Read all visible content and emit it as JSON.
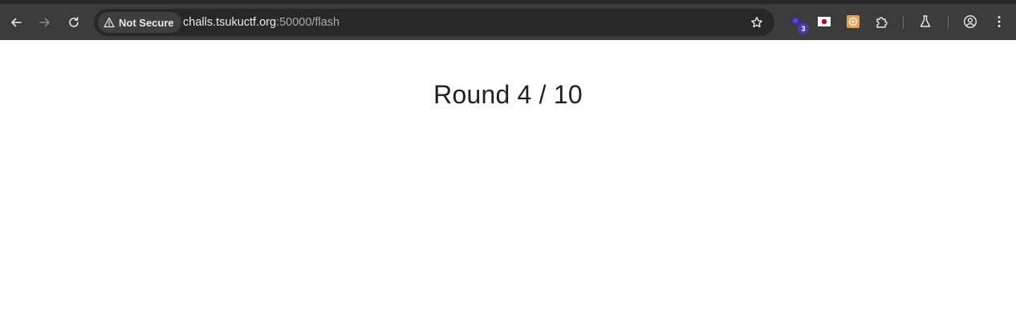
{
  "browser": {
    "security_label": "Not Secure",
    "url_host": "challs.tsukuctf.org",
    "url_path": ":50000/flash",
    "extensions": [
      {
        "name": "shield-extension",
        "badge": "3"
      },
      {
        "name": "japan-flag-extension"
      },
      {
        "name": "orange-extension"
      }
    ]
  },
  "page": {
    "heading": "Round 4 / 10"
  },
  "colors": {
    "toolbar": "#3c3c3c",
    "omnibox": "#282828",
    "text_primary": "#e8eaed",
    "badge": "#4b3ab6"
  }
}
